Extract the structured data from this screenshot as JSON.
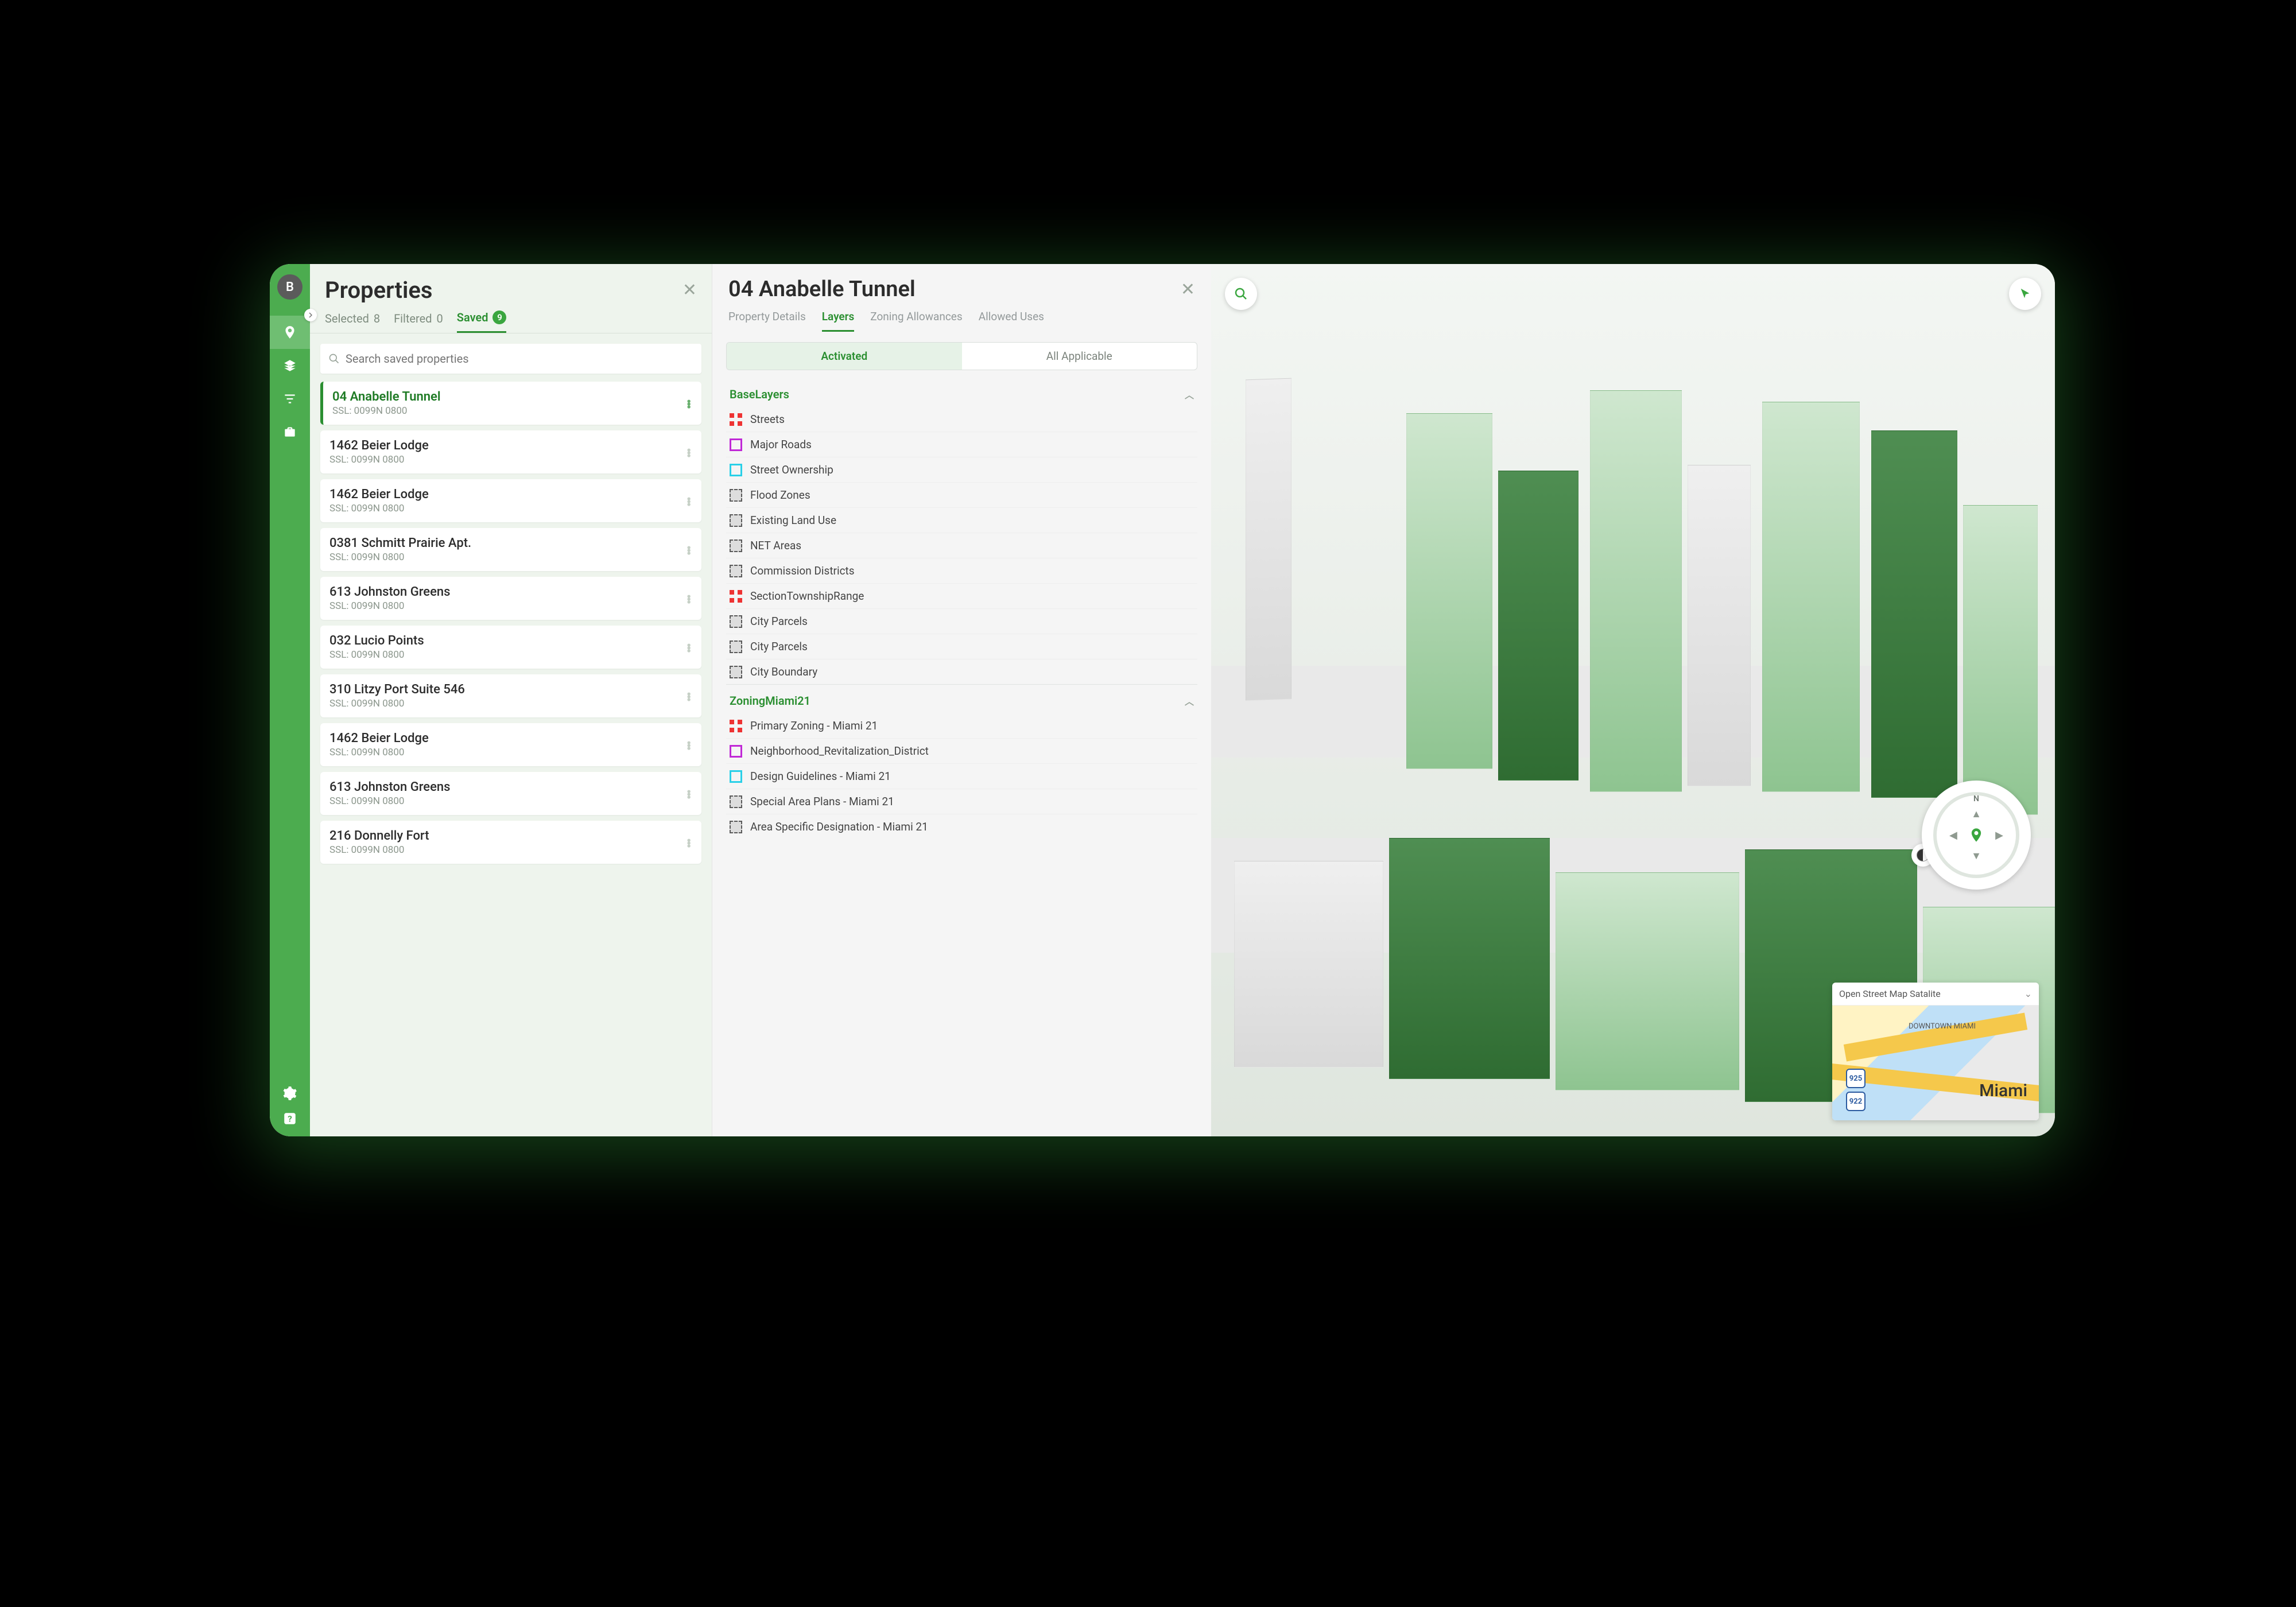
{
  "rail": {
    "avatar_initial": "B"
  },
  "properties": {
    "title": "Properties",
    "tabs": {
      "selected_label": "Selected",
      "selected_count": "8",
      "filtered_label": "Filtered",
      "filtered_count": "0",
      "saved_label": "Saved",
      "saved_count": "9"
    },
    "search_placeholder": "Search saved properties",
    "items": [
      {
        "name": "04 Anabelle Tunnel",
        "sub": "SSL: 0099N 0800",
        "selected": true
      },
      {
        "name": "1462 Beier Lodge",
        "sub": "SSL: 0099N 0800"
      },
      {
        "name": "1462 Beier Lodge",
        "sub": "SSL: 0099N 0800"
      },
      {
        "name": "0381 Schmitt Prairie Apt.",
        "sub": "SSL: 0099N 0800"
      },
      {
        "name": "613 Johnston Greens",
        "sub": "SSL: 0099N 0800"
      },
      {
        "name": "032 Lucio Points",
        "sub": "SSL: 0099N 0800"
      },
      {
        "name": "310 Litzy Port Suite 546",
        "sub": "SSL: 0099N 0800"
      },
      {
        "name": "1462 Beier Lodge",
        "sub": "SSL: 0099N 0800"
      },
      {
        "name": "613 Johnston Greens",
        "sub": "SSL: 0099N 0800"
      },
      {
        "name": "216 Donnelly Fort",
        "sub": "SSL: 0099N 0800"
      }
    ]
  },
  "detail": {
    "title": "04 Anabelle Tunnel",
    "tabs": {
      "property_details": "Property Details",
      "layers": "Layers",
      "zoning_allowances": "Zoning Allowances",
      "allowed_uses": "Allowed Uses"
    },
    "segmented": {
      "activated": "Activated",
      "all": "All Applicable"
    },
    "groups": [
      {
        "name": "BaseLayers",
        "layers": [
          {
            "label": "Streets",
            "swatch": "dots"
          },
          {
            "label": "Major Roads",
            "swatch": "sq"
          },
          {
            "label": "Street Ownership",
            "swatch": "sq-cyan"
          },
          {
            "label": "Flood Zones",
            "swatch": "dashed"
          },
          {
            "label": "Existing Land Use",
            "swatch": "dashed"
          },
          {
            "label": "NET Areas",
            "swatch": "dashed"
          },
          {
            "label": "Commission Districts",
            "swatch": "dashed"
          },
          {
            "label": "SectionTownshipRange",
            "swatch": "dots"
          },
          {
            "label": "City Parcels",
            "swatch": "dashed"
          },
          {
            "label": "City Parcels",
            "swatch": "dashed"
          },
          {
            "label": "City Boundary",
            "swatch": "dashed"
          }
        ]
      },
      {
        "name": "ZoningMiami21",
        "layers": [
          {
            "label": "Primary Zoning - Miami 21",
            "swatch": "dots"
          },
          {
            "label": "Neighborhood_Revitalization_District",
            "swatch": "sq"
          },
          {
            "label": "Design Guidelines - Miami 21",
            "swatch": "sq-cyan"
          },
          {
            "label": "Special Area Plans - Miami 21",
            "swatch": "dashed"
          },
          {
            "label": "Area Specific Designation - Miami 21",
            "swatch": "dashed"
          }
        ]
      }
    ]
  },
  "map": {
    "compass_n": "N",
    "minimap": {
      "title": "Open Street Map Satalite",
      "city": "Miami",
      "district": "DOWNTOWN MIAMI",
      "shields": [
        "925",
        "922"
      ]
    }
  }
}
